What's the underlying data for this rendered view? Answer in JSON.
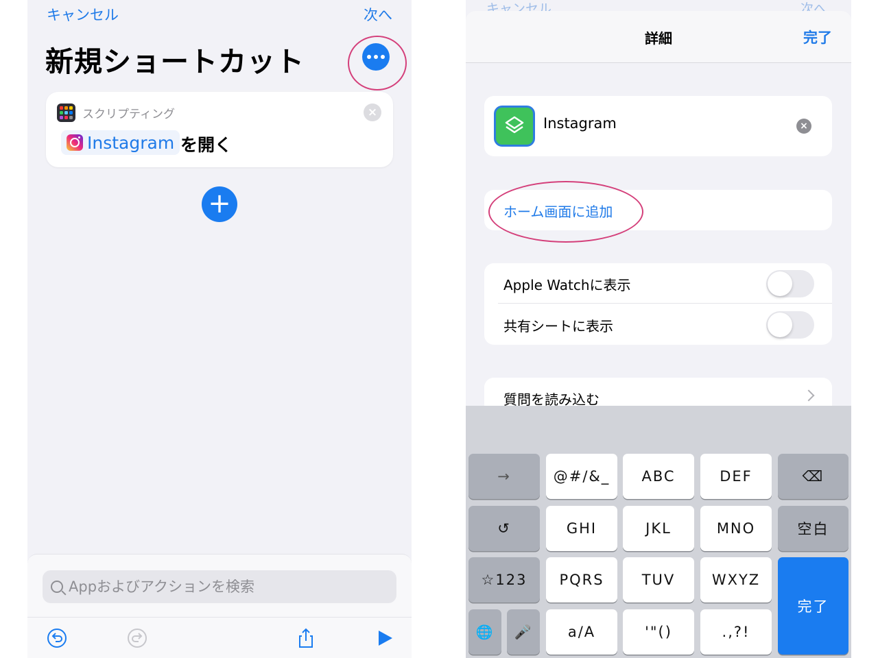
{
  "left": {
    "nav": {
      "cancel": "キャンセル",
      "next": "次へ"
    },
    "title": "新規ショートカット",
    "card": {
      "category": "スクリプティング",
      "app_name": "Instagram",
      "verb": "を開く"
    },
    "search": {
      "placeholder": "Appおよびアクションを検索"
    }
  },
  "right": {
    "ghost_nav": {
      "cancel": "キャンセル",
      "next": "次へ"
    },
    "sheet": {
      "title": "詳細",
      "done": "完了"
    },
    "shortcut_name": "Instagram",
    "add_to_home": "ホーム画面に追加",
    "toggles": [
      {
        "label": "Apple Watchに表示",
        "on": false
      },
      {
        "label": "共有シートに表示",
        "on": false
      }
    ],
    "question": "質問を読み込む",
    "keyboard": {
      "row1": [
        "→",
        "@#/&_",
        "ABC",
        "DEF",
        "⌫"
      ],
      "row2": [
        "↺",
        "GHI",
        "JKL",
        "MNO",
        "空白"
      ],
      "row3": [
        "☆123",
        "PQRS",
        "TUV",
        "WXYZ"
      ],
      "row4": [
        "🌐",
        "🎤",
        "a/A",
        "'\"()",
        ".,?!"
      ],
      "done": "完了"
    }
  },
  "colors": {
    "accent": "#1a7cf0",
    "highlight": "#d43f7a",
    "background": "#f2f2f7"
  }
}
